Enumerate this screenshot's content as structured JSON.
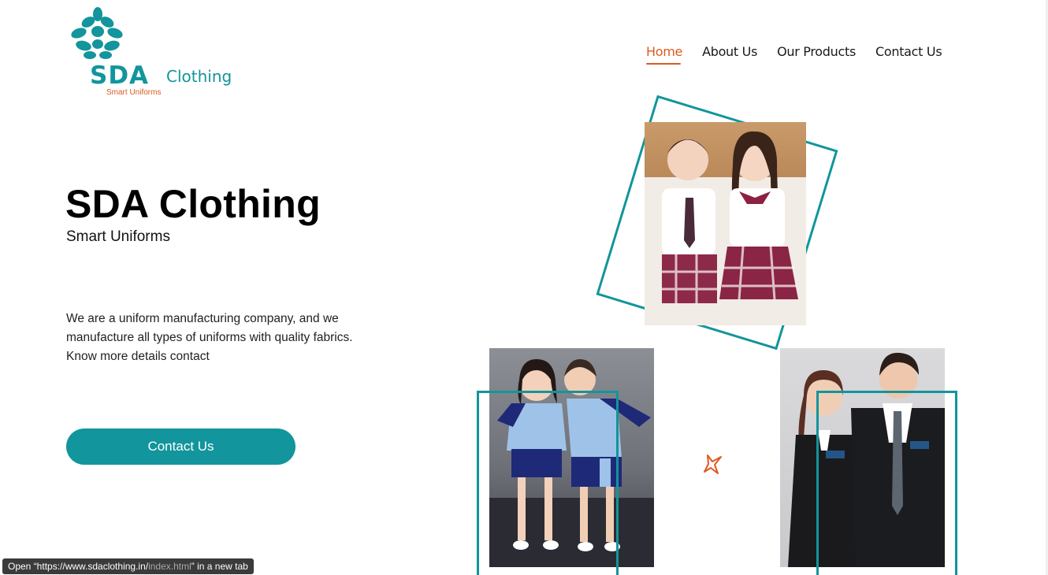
{
  "logo": {
    "brand": "SDA",
    "brand_suffix": "Clothing",
    "tagline": "Smart Uniforms"
  },
  "nav": {
    "items": [
      {
        "label": "Home",
        "active": true
      },
      {
        "label": "About Us",
        "active": false
      },
      {
        "label": "Our Products",
        "active": false
      },
      {
        "label": "Contact Us",
        "active": false
      }
    ]
  },
  "hero": {
    "title": "SDA Clothing",
    "subtitle": "Smart Uniforms",
    "description": "We are a uniform manufacturing company, and we manufacture all types of uniforms with quality fabrics. Know more details contact",
    "cta_label": "Contact Us"
  },
  "status_bar": {
    "prefix": "Open “https://www.sdaclothing.in/",
    "dim_part": "index.html",
    "suffix": "” in a new tab"
  },
  "colors": {
    "accent": "#12959c",
    "secondary": "#dc5a22"
  }
}
